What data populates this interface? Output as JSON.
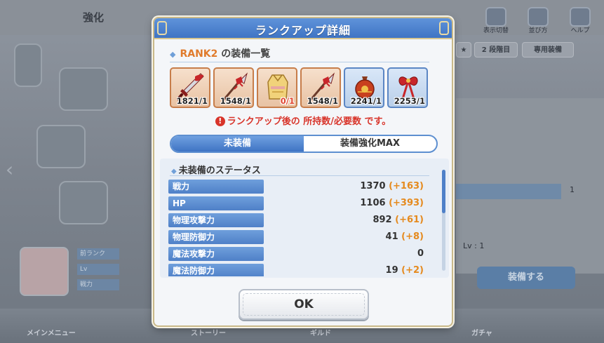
{
  "background": {
    "tab_label": "強化",
    "top_icons": [
      "表示切替",
      "並び方",
      "ヘルプ"
    ],
    "chips": [
      "★",
      "2 段階目",
      "専用装備"
    ],
    "stat_labels": [
      "前ランク",
      "Lv",
      "戦力"
    ],
    "right_value": "1",
    "right_level": "Lv : 1",
    "equip_button": "装備する",
    "bottom_labels": [
      "メインメニュー",
      "ストーリー",
      "ギルド",
      "ガチャ"
    ]
  },
  "modal": {
    "title": "ランクアップ詳細",
    "section_rank": "RANK2",
    "section_suffix": " の装備一覧",
    "equipment": [
      {
        "icon": "red-sword-icon",
        "count": "1821/1",
        "shortage": false,
        "frame": "orange"
      },
      {
        "icon": "red-spear-icon",
        "count": "1548/1",
        "shortage": false,
        "frame": "orange"
      },
      {
        "icon": "yellow-robe-icon",
        "count": "0/1",
        "shortage": true,
        "frame": "orange"
      },
      {
        "icon": "red-spear-icon",
        "count": "1548/1",
        "shortage": false,
        "frame": "orange"
      },
      {
        "icon": "red-pouch-icon",
        "count": "2241/1",
        "shortage": false,
        "frame": "blue"
      },
      {
        "icon": "red-ribbon-icon",
        "count": "2253/1",
        "shortage": false,
        "frame": "blue"
      }
    ],
    "notice": "ランクアップ後の 所持数/必要数 です。",
    "tabs": [
      "未装備",
      "装備強化MAX"
    ],
    "active_tab": 0,
    "stats_title": "未装備のステータス",
    "stats": [
      {
        "label": "戦力",
        "value": "1370",
        "bonus": "(+163)"
      },
      {
        "label": "HP",
        "value": "1106",
        "bonus": "(+393)"
      },
      {
        "label": "物理攻撃力",
        "value": "892",
        "bonus": "(+61)"
      },
      {
        "label": "物理防御力",
        "value": "41",
        "bonus": "(+8)"
      },
      {
        "label": "魔法攻撃力",
        "value": "0",
        "bonus": ""
      },
      {
        "label": "魔法防御力",
        "value": "19",
        "bonus": "(+2)"
      }
    ],
    "ok_label": "OK"
  }
}
